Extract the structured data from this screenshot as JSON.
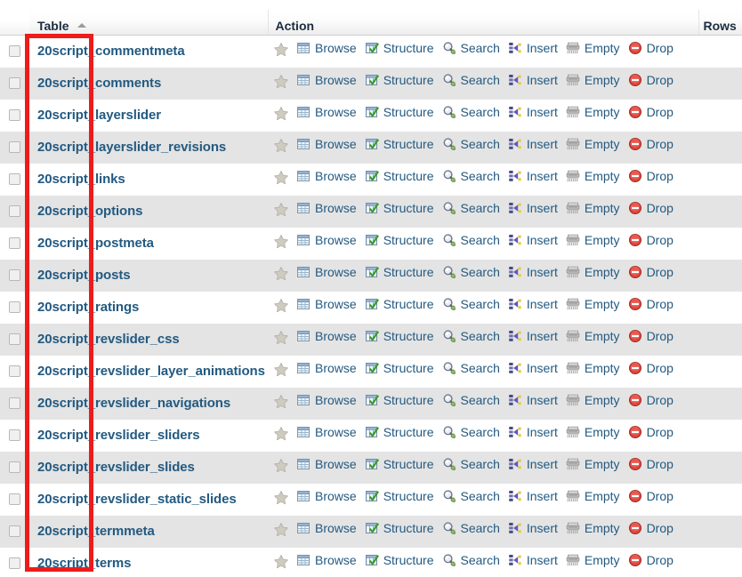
{
  "header": {
    "columns": [
      {
        "key": "checkbox",
        "label": ""
      },
      {
        "key": "table",
        "label": "Table",
        "sort": "asc",
        "sort_icon": "sort-asc-arrow-icon"
      },
      {
        "key": "action",
        "label": "Action"
      },
      {
        "key": "rows",
        "label": "Rows"
      }
    ]
  },
  "actions": [
    {
      "name": "favorite",
      "label": "",
      "icon": "star-icon"
    },
    {
      "name": "browse",
      "label": "Browse",
      "icon": "grid-table-icon"
    },
    {
      "name": "structure",
      "label": "Structure",
      "icon": "structure-checkmark-icon"
    },
    {
      "name": "search",
      "label": "Search",
      "icon": "magnifier-icon"
    },
    {
      "name": "insert",
      "label": "Insert",
      "icon": "insert-row-icon"
    },
    {
      "name": "empty",
      "label": "Empty",
      "icon": "shredder-icon"
    },
    {
      "name": "drop",
      "label": "Drop",
      "icon": "red-minus-circle-icon"
    }
  ],
  "rows": [
    {
      "name": "20script_commentmeta",
      "rows": ""
    },
    {
      "name": "20script_comments",
      "rows": ""
    },
    {
      "name": "20script_layerslider",
      "rows": ""
    },
    {
      "name": "20script_layerslider_revisions",
      "rows": ""
    },
    {
      "name": "20script_links",
      "rows": ""
    },
    {
      "name": "20script_options",
      "rows": ""
    },
    {
      "name": "20script_postmeta",
      "rows": ""
    },
    {
      "name": "20script_posts",
      "rows": ""
    },
    {
      "name": "20script_ratings",
      "rows": ""
    },
    {
      "name": "20script_revslider_css",
      "rows": ""
    },
    {
      "name": "20script_revslider_layer_animations",
      "rows": ""
    },
    {
      "name": "20script_revslider_navigations",
      "rows": ""
    },
    {
      "name": "20script_revslider_sliders",
      "rows": ""
    },
    {
      "name": "20script_revslider_slides",
      "rows": ""
    },
    {
      "name": "20script_revslider_static_slides",
      "rows": ""
    },
    {
      "name": "20script_termmeta",
      "rows": ""
    },
    {
      "name": "20script_terms",
      "rows": ""
    }
  ],
  "annotation": {
    "shape": "rectangle",
    "color": "#ee1b1b"
  },
  "colors": {
    "link": "#235a81",
    "header_text": "#1c2c3e",
    "row_alt": "#e4e4e4",
    "row_base": "#ffffff",
    "annotation": "#ee1b1b"
  }
}
